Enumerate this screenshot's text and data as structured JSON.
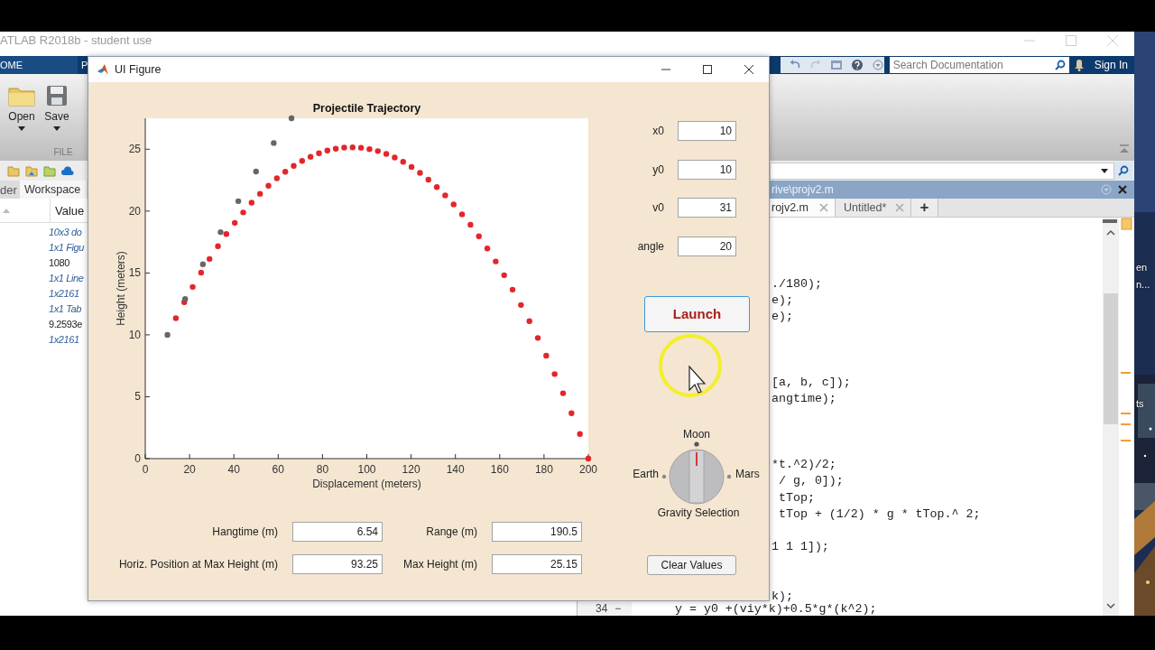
{
  "matlab": {
    "title": "ATLAB R2018b - student use",
    "ribbon_tabs": [
      {
        "label": "OME",
        "selected": true
      },
      {
        "label": "P",
        "selected": false
      }
    ],
    "toolstrip": {
      "buttons": [
        {
          "label": "Open",
          "kind": "folder"
        },
        {
          "label": "Save",
          "kind": "disk"
        }
      ],
      "section": "FILE"
    },
    "search": {
      "placeholder": "Search Documentation"
    },
    "sign_in": "Sign In",
    "panel_tabs": [
      {
        "label": "der",
        "selected": false
      },
      {
        "label": "Workspace",
        "selected": true
      }
    ],
    "workspace": {
      "column": "Value",
      "values": [
        {
          "text": "10x3 do",
          "kind": "object"
        },
        {
          "text": "1x1 Figu",
          "kind": "object"
        },
        {
          "text": "1080",
          "kind": "number"
        },
        {
          "text": "1x1 Line",
          "kind": "object"
        },
        {
          "text": "1x2161",
          "kind": "object"
        },
        {
          "text": "1x1 Tab",
          "kind": "object"
        },
        {
          "text": "9.2593e",
          "kind": "number"
        },
        {
          "text": "1x2161",
          "kind": "object"
        }
      ]
    },
    "editor": {
      "path": "rive\\projv2.m",
      "tabs": [
        {
          "label": "rojv2.m",
          "selected": true
        },
        {
          "label": "Untitled*",
          "selected": false
        }
      ],
      "new_tab": "+",
      "lines": [
        {
          "text": "./180);"
        },
        {
          "text": "e);"
        },
        {
          "text": "e);"
        },
        {
          "text": "[a, b, c]);"
        },
        {
          "text": "angtime);"
        },
        {
          "text": "*t.^2)/2;"
        },
        {
          "text": " / g, 0]);"
        },
        {
          "text": " tTop;"
        },
        {
          "text": " tTop + (1/2) * g * tTop.^ 2;"
        },
        {
          "text": "1 1 1]);"
        },
        {
          "text": "k);"
        },
        {
          "number": "34",
          "marker": "−",
          "text": "y = y0 +(viy*k)+0.5*g*(k^2);"
        }
      ]
    }
  },
  "desktop_labels": [
    "en",
    "n...",
    "ts"
  ],
  "figure": {
    "title": "UI Figure",
    "chart_data": {
      "type": "scatter",
      "title": "Projectile Trajectory",
      "xlabel": "Displacement (meters)",
      "ylabel": "Height (meters)",
      "xlim": [
        0,
        200
      ],
      "ylim": [
        0,
        27.5
      ],
      "xticks": [
        0,
        20,
        40,
        60,
        80,
        100,
        120,
        140,
        160,
        180,
        200
      ],
      "yticks": [
        0,
        5,
        10,
        15,
        20,
        25
      ],
      "x": [
        10,
        13.8,
        17.6,
        18,
        21.4,
        25.2,
        26,
        29,
        32.8,
        34,
        36.6,
        40.4,
        42,
        44.2,
        48,
        50,
        51.8,
        55.6,
        58,
        59.4,
        63.2,
        66,
        67,
        70.8,
        74.6,
        78.4,
        82.2,
        86,
        89.8,
        93.6,
        97.4,
        101.2,
        105,
        108.8,
        112.6,
        116.4,
        120.2,
        124,
        127.8,
        131.6,
        135.4,
        139.2,
        143,
        146.8,
        150.6,
        154.4,
        158.2,
        162,
        165.8,
        169.6,
        173.4,
        177.2,
        181,
        184.8,
        188.6,
        192.4,
        196.2,
        200
      ],
      "series": [
        {
          "color": "#e3262b",
          "values": [
            null,
            11.35,
            12.64,
            null,
            13.87,
            15.03,
            null,
            16.13,
            17.16,
            null,
            18.14,
            19.05,
            null,
            19.89,
            20.68,
            null,
            21.4,
            22.05,
            null,
            22.65,
            23.18,
            null,
            23.65,
            24.05,
            24.39,
            24.67,
            24.89,
            25.04,
            25.13,
            25.15,
            25.12,
            25.01,
            24.85,
            24.62,
            24.33,
            23.98,
            23.57,
            23.09,
            22.54,
            21.94,
            21.27,
            20.54,
            19.74,
            18.89,
            17.96,
            16.98,
            15.93,
            14.82,
            13.65,
            12.41,
            11.11,
            9.75,
            8.32,
            6.83,
            5.28,
            3.66,
            1.99,
            0
          ]
        },
        {
          "color": "#666666",
          "values": [
            10,
            null,
            null,
            12.9,
            null,
            null,
            15.7,
            null,
            null,
            18.3,
            null,
            null,
            20.8,
            null,
            null,
            23.2,
            null,
            null,
            25.5,
            null,
            null,
            27.5,
            null,
            null,
            null,
            null,
            null,
            null,
            null,
            null,
            null,
            null,
            null,
            null,
            null,
            null,
            null,
            null,
            null,
            null,
            null,
            null,
            null,
            null,
            null,
            null,
            null,
            null,
            null,
            null,
            null,
            null,
            null,
            null,
            null,
            null,
            null,
            null
          ]
        }
      ]
    },
    "inputs": [
      {
        "label": "x0",
        "value": "10"
      },
      {
        "label": "y0",
        "value": "10"
      },
      {
        "label": "v0",
        "value": "31"
      },
      {
        "label": "angle",
        "value": "20"
      }
    ],
    "launch": "Launch",
    "knob": {
      "label": "Gravity Selection",
      "options": [
        {
          "label": "Earth",
          "selected": false
        },
        {
          "label": "Moon",
          "selected": true
        },
        {
          "label": "Mars",
          "selected": false
        }
      ]
    },
    "outputs": [
      {
        "label": "Hangtime (m)",
        "value": "6.54"
      },
      {
        "label": "Range (m)",
        "value": "190.5"
      },
      {
        "label": "Horiz. Position at Max Height (m)",
        "value": "93.25"
      },
      {
        "label": "Max Height (m)",
        "value": "25.15"
      }
    ],
    "clear": "Clear Values"
  }
}
